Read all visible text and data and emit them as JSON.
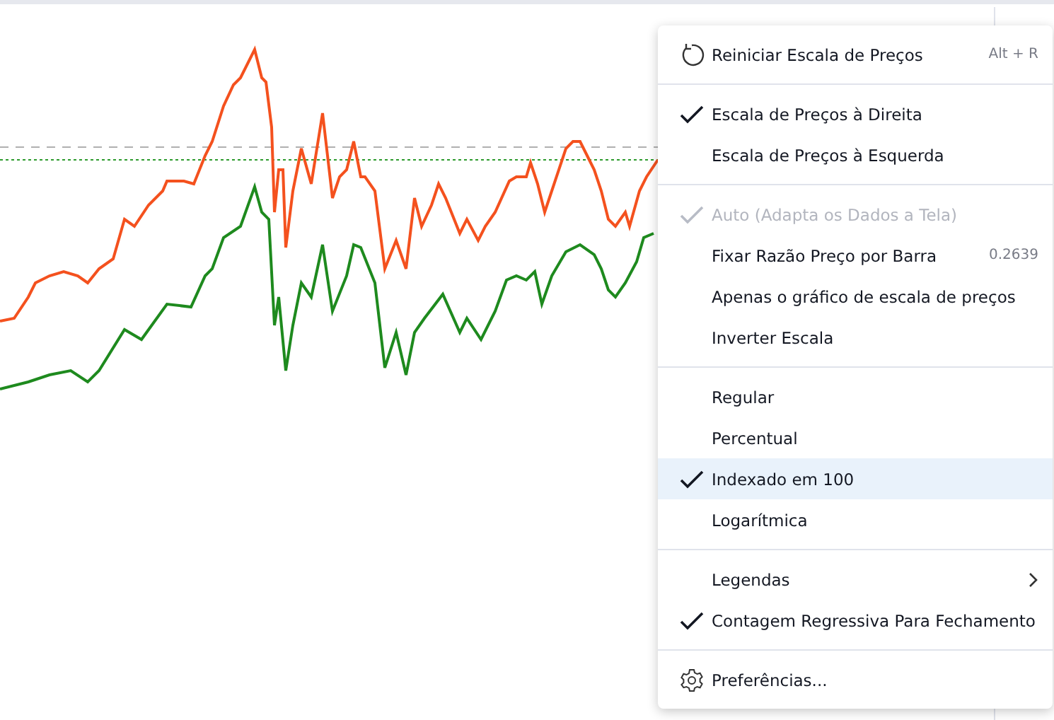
{
  "menu": {
    "groups": [
      {
        "items": [
          {
            "kind": "reset",
            "label": "Reiniciar Escala de Preços",
            "shortcut": "Alt + R",
            "disabled": false,
            "selected": false
          }
        ]
      },
      {
        "items": [
          {
            "kind": "toggle",
            "label": "Escala de Preços à Direita",
            "checked": true,
            "disabled": false,
            "selected": false
          },
          {
            "kind": "toggle",
            "label": "Escala de Preços à Esquerda",
            "checked": false,
            "disabled": false,
            "selected": false
          }
        ]
      },
      {
        "items": [
          {
            "kind": "toggle",
            "label": "Auto (Adapta os Dados a Tela)",
            "checked": true,
            "disabled": true,
            "selected": false
          },
          {
            "kind": "toggle",
            "label": "Fixar Razão Preço por Barra",
            "shortcut": "0.2639",
            "checked": false,
            "disabled": false,
            "selected": false
          },
          {
            "kind": "toggle",
            "label": "Apenas o gráfico de escala de preços",
            "checked": false,
            "disabled": false,
            "selected": false
          },
          {
            "kind": "toggle",
            "label": "Inverter Escala",
            "checked": false,
            "disabled": false,
            "selected": false
          }
        ]
      },
      {
        "items": [
          {
            "kind": "toggle",
            "label": "Regular",
            "checked": false,
            "disabled": false,
            "selected": false
          },
          {
            "kind": "toggle",
            "label": "Percentual",
            "checked": false,
            "disabled": false,
            "selected": false
          },
          {
            "kind": "toggle",
            "label": "Indexado em 100",
            "checked": true,
            "disabled": false,
            "selected": true
          },
          {
            "kind": "toggle",
            "label": "Logarítmica",
            "checked": false,
            "disabled": false,
            "selected": false
          }
        ]
      },
      {
        "items": [
          {
            "kind": "submenu",
            "label": "Legendas",
            "disabled": false,
            "selected": false
          },
          {
            "kind": "toggle",
            "label": "Contagem Regressiva Para Fechamento",
            "checked": true,
            "disabled": false,
            "selected": false
          }
        ]
      },
      {
        "items": [
          {
            "kind": "settings",
            "label": "Preferências...",
            "disabled": false,
            "selected": false
          }
        ]
      }
    ]
  }
}
